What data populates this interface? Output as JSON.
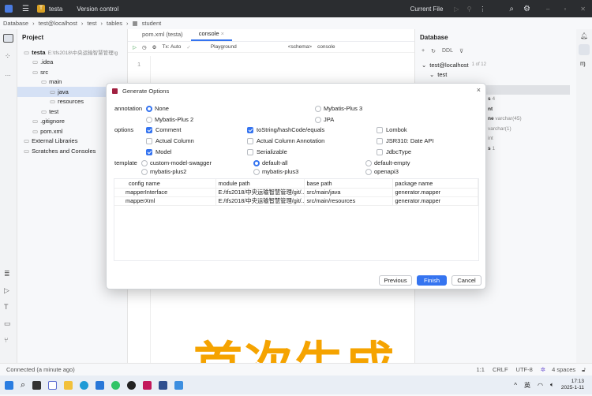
{
  "titlebar": {
    "project": "testa",
    "project_badge": "T",
    "vcs": "Version control",
    "run_config": "Current File"
  },
  "breadcrumb": [
    "Database",
    "test@localhost",
    "test",
    "tables",
    "student"
  ],
  "project_panel": {
    "title": "Project",
    "items": [
      {
        "label": "testa",
        "extra": "E:\\tfs2018\\中央运输智慧管理\\g",
        "indent": 0
      },
      {
        "label": ".idea",
        "indent": 1
      },
      {
        "label": "src",
        "indent": 1
      },
      {
        "label": "main",
        "indent": 2
      },
      {
        "label": "java",
        "indent": 3,
        "selected": true
      },
      {
        "label": "resources",
        "indent": 3
      },
      {
        "label": "test",
        "indent": 2
      },
      {
        "label": ".gitignore",
        "indent": 1
      },
      {
        "label": "pom.xml",
        "indent": 1
      },
      {
        "label": "External Libraries",
        "indent": 0
      },
      {
        "label": "Scratches and Consoles",
        "indent": 0
      }
    ]
  },
  "editor": {
    "tabs": [
      "pom.xml (testa)",
      "console"
    ],
    "tx": "Tx: Auto",
    "playground": "Playground",
    "schema": "<schema>",
    "console": "console",
    "line": "1"
  },
  "db_panel": {
    "title": "Database",
    "toolbar_ddl": "DDL",
    "host": "test@localhost",
    "host_count": "1 of 12",
    "schema": "test",
    "hints": [
      {
        "text": "s",
        "extra": "4"
      },
      {
        "text": "nt",
        "extra": ""
      },
      {
        "text": "ne",
        "extra": "varchar(45)"
      },
      {
        "text": "",
        "extra": "varchar(1)"
      },
      {
        "text": "",
        "extra": "int"
      },
      {
        "text": "s",
        "extra": "1"
      }
    ]
  },
  "dialog": {
    "title": "Generate Options",
    "annotation_label": "annotation",
    "annotation_options": [
      "None",
      "Mybatis-Plus 3",
      "Mybatis-Plus 2",
      "JPA"
    ],
    "annotation_selected": "None",
    "options_label": "options",
    "options": [
      {
        "label": "Comment",
        "checked": true
      },
      {
        "label": "toString/hashCode/equals",
        "checked": true
      },
      {
        "label": "Lombok",
        "checked": false
      },
      {
        "label": "Actual Column",
        "checked": false
      },
      {
        "label": "Actual Column Annotation",
        "checked": false
      },
      {
        "label": "JSR310: Date API",
        "checked": false
      },
      {
        "label": "Model",
        "checked": true
      },
      {
        "label": "Serializable",
        "checked": false
      },
      {
        "label": "JdbcType",
        "checked": false
      }
    ],
    "template_label": "template",
    "templates": [
      "custom-model-swagger",
      "default-all",
      "default-empty",
      "mybatis-plus2",
      "mybatis-plus3",
      "openapi3"
    ],
    "template_selected": "default-all",
    "table": {
      "headers": [
        "config name",
        "module path",
        "base path",
        "package name"
      ],
      "rows": [
        [
          "mapperInterface",
          "E:/tfs2018/中央运输智慧管理/git/...",
          "src/main/java",
          "generator.mapper"
        ],
        [
          "mapperXml",
          "E:/tfs2018/中央运输智慧管理/git/...",
          "src/main/resources",
          "generator.mapper"
        ]
      ]
    },
    "buttons": {
      "previous": "Previous",
      "finish": "Finish",
      "cancel": "Cancel"
    }
  },
  "status": {
    "left": "Connected (a minute ago)",
    "position": "1:1",
    "line_sep": "CRLF",
    "encoding": "UTF-8",
    "indent": "4 spaces"
  },
  "taskbar": {
    "time": "17:13",
    "date": "2025-1-11",
    "ime": "英"
  },
  "caption": "首次生成",
  "colors": {
    "accent": "#3574f0",
    "caption": "#f5a300",
    "titlebar": "#2b2d30"
  }
}
